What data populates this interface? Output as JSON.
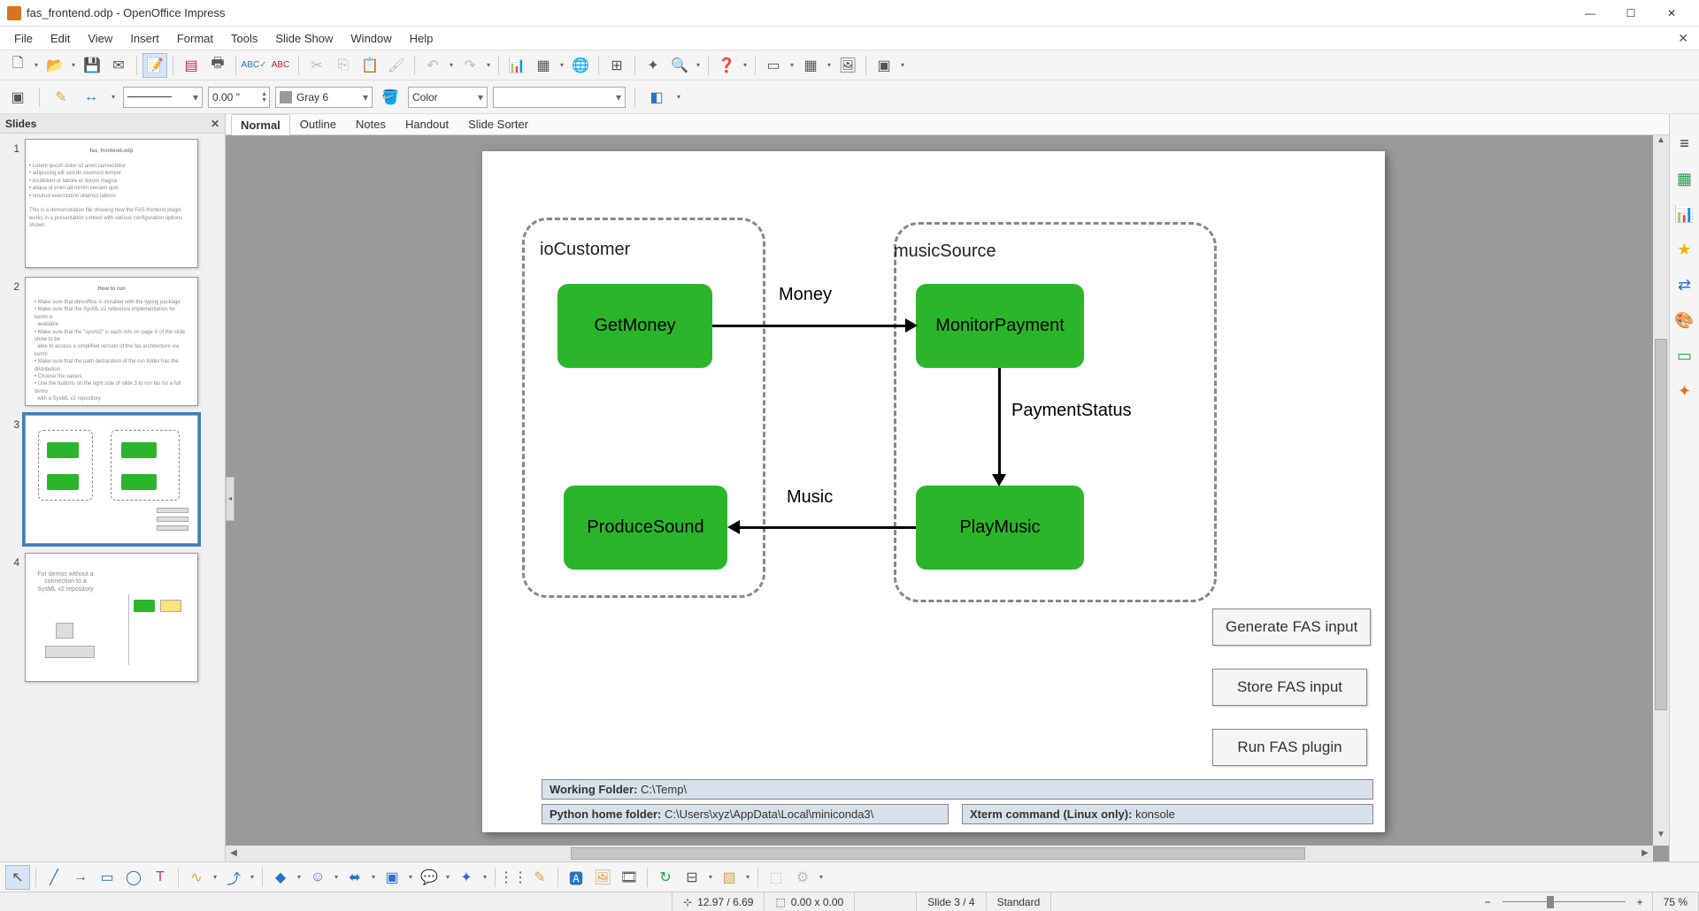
{
  "window": {
    "title": "fas_frontend.odp - OpenOffice Impress"
  },
  "menubar": [
    "File",
    "Edit",
    "View",
    "Insert",
    "Format",
    "Tools",
    "Slide Show",
    "Window",
    "Help"
  ],
  "toolbar2": {
    "line_width": "0.00 \"",
    "line_color_label": "Gray 6",
    "fill_type": "Color",
    "fill_value": ""
  },
  "slides_panel": {
    "title": "Slides",
    "thumbs": [
      {
        "num": "1",
        "title": "fas_frontend.odp"
      },
      {
        "num": "2",
        "title": "How to run"
      },
      {
        "num": "3",
        "title": ""
      },
      {
        "num": "4",
        "title": "For demos without a connection to a SysML v2 repository"
      }
    ]
  },
  "view_tabs": [
    "Normal",
    "Outline",
    "Notes",
    "Handout",
    "Slide Sorter"
  ],
  "slide": {
    "group1_label": "ioCustomer",
    "group2_label": "musicSource",
    "box1": "GetMoney",
    "box2": "MonitorPayment",
    "box3": "ProduceSound",
    "box4": "PlayMusic",
    "arrow1_label": "Money",
    "arrow2_label": "PaymentStatus",
    "arrow3_label": "Music",
    "btn1": "Generate FAS input",
    "btn2": "Store FAS input",
    "btn3": "Run FAS plugin",
    "info1_label": "Working Folder:",
    "info1_value": " C:\\Temp\\",
    "info2_label": "Python home folder:",
    "info2_value": " C:\\Users\\xyz\\AppData\\Local\\miniconda3\\",
    "info3_label": "Xterm command (Linux only):",
    "info3_value": " konsole"
  },
  "statusbar": {
    "pos": "12.97 / 6.69",
    "size": "0.00 x 0.00",
    "slide": "Slide 3 / 4",
    "template": "Standard",
    "zoom": "75 %"
  }
}
